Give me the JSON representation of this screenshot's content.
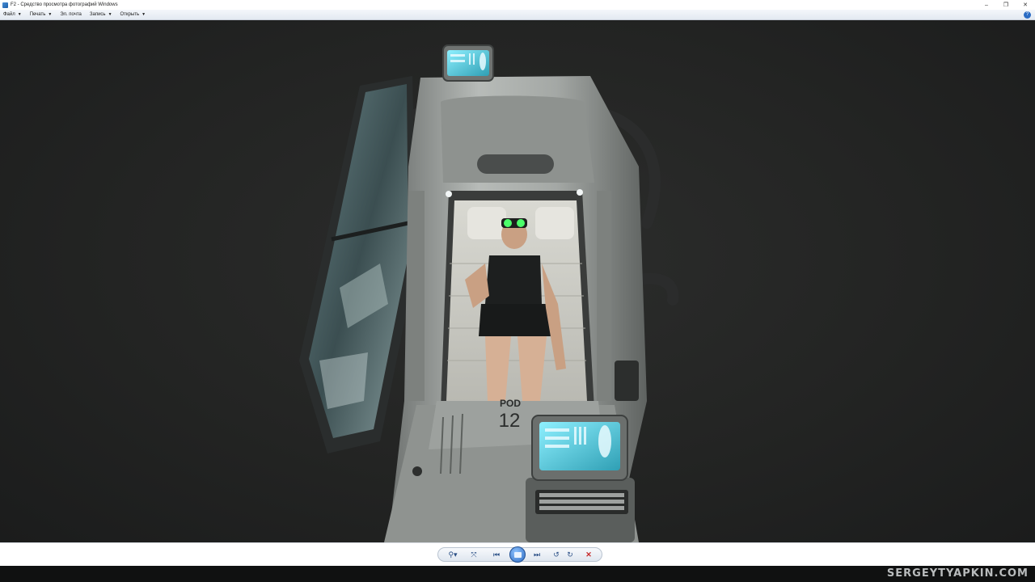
{
  "window": {
    "title": "F2 - Средство просмотра фотографий Windows",
    "controls": {
      "minimize": "–",
      "restore": "❐",
      "close": "✕"
    }
  },
  "menubar": {
    "items": [
      {
        "label": "Файл",
        "caret": "▼"
      },
      {
        "label": "Печать",
        "caret": "▼"
      },
      {
        "label": "Эл. почта",
        "caret": ""
      },
      {
        "label": "Запись",
        "caret": "▼"
      },
      {
        "label": "Открыть",
        "caret": "▼"
      }
    ],
    "help_icon": "help-icon",
    "help_glyph": "?"
  },
  "photo": {
    "pod_label": "POD",
    "pod_number": "12"
  },
  "controls": {
    "zoom": "⚲▾",
    "fit": "⤧",
    "previous": "⏮",
    "next": "⏭",
    "rotate_ccw": "↺",
    "rotate_cw": "↻",
    "delete": "✕"
  },
  "watermark": "SERGEYTYAPKIN.COM",
  "colors": {
    "accent": "#2f6cc2",
    "screen": "#5fd6e6",
    "visor": "#4cff6a",
    "delete": "#c62828"
  }
}
